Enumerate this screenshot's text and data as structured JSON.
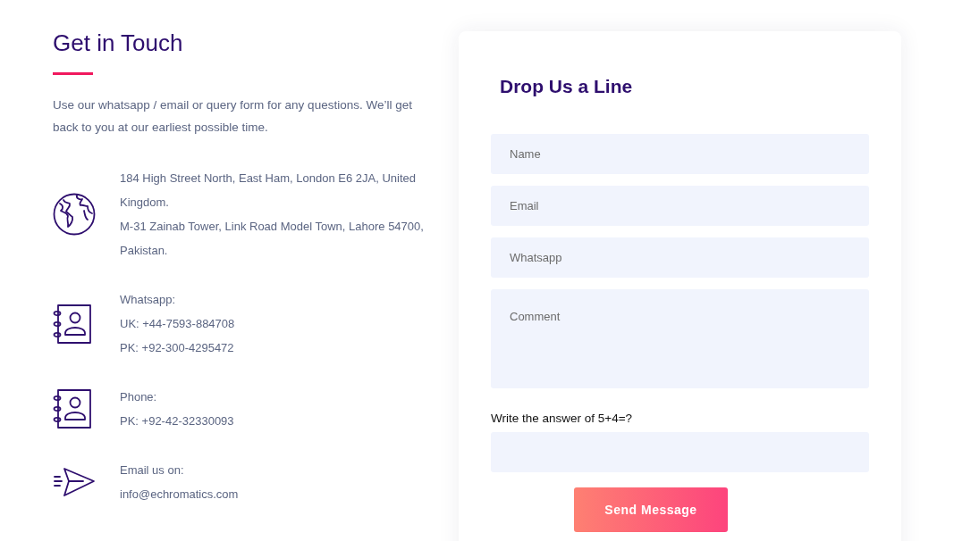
{
  "heading": "Get in Touch",
  "intro": "Use our whatsapp / email or query form for any questions. We’ll get back to you at our earliest possible time.",
  "contacts": [
    {
      "kind": "globe",
      "lines": [
        "184 High Street North, East Ham, London E6 2JA, United Kingdom.",
        "M-31 Zainab Tower, Link Road Model Town, Lahore 54700, Pakistan."
      ]
    },
    {
      "kind": "contact-book",
      "lines": [
        "Whatsapp:",
        "UK: +44-7593-884708",
        "PK: +92-300-4295472"
      ]
    },
    {
      "kind": "contact-book",
      "lines": [
        "Phone:",
        "PK: +92-42-32330093"
      ]
    },
    {
      "kind": "paper-plane",
      "lines": [
        "Email us on:",
        "info@echromatics.com"
      ]
    }
  ],
  "form": {
    "title": "Drop Us a Line",
    "fields": [
      {
        "kind": "input",
        "placeholder": "Name"
      },
      {
        "kind": "input",
        "placeholder": "Email"
      },
      {
        "kind": "input",
        "placeholder": "Whatsapp"
      },
      {
        "kind": "textarea",
        "placeholder": "Comment"
      }
    ],
    "captcha_label": "Write the answer of 5+4=?",
    "submit": "Send Message"
  }
}
